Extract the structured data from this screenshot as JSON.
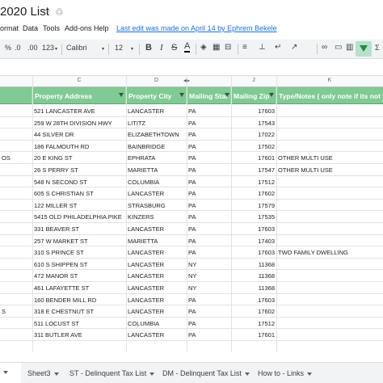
{
  "title": {
    "doc_name": "2020 List",
    "star_glyph": "☆",
    "drive_glyph": "♲"
  },
  "menu": {
    "items": [
      "ormat",
      "Data",
      "Tools",
      "Add-ons",
      "Help"
    ],
    "last_edit": "Last edit was made on April 14 by Ephrem Bekele"
  },
  "toolbar": {
    "percent": "%",
    "decimal_less": ".0",
    "decimal_more": ".00",
    "format_more": "123",
    "font": "Calibri",
    "font_size": "12",
    "bold": "B",
    "italic": "I",
    "strike": "S",
    "text_color": "A"
  },
  "columns": {
    "letters": [
      "C",
      "D",
      "",
      "",
      "J",
      "K"
    ]
  },
  "headers": {
    "address": "Property Address",
    "city": "Property City",
    "state": "Mailing Stat",
    "zip": "Mailing Zip",
    "type": "Type/Notes ( only note if its not S"
  },
  "rows": [
    {
      "edge": "",
      "address": "521 LANCASTER AVE",
      "city": "Lancaster",
      "state": "PA",
      "zip": "17603",
      "type": ""
    },
    {
      "edge": "",
      "address": "259 W 28TH DIVISION HWY",
      "city": "Lititz",
      "state": "PA",
      "zip": "17543",
      "type": ""
    },
    {
      "edge": "",
      "address": "44 SILVER DR",
      "city": "ELIZABETHTOWN",
      "state": "PA",
      "zip": "17022",
      "type": ""
    },
    {
      "edge": "",
      "address": "186 FALMOUTH RD",
      "city": "BAINBRIDGE",
      "state": "PA",
      "zip": "17502",
      "type": ""
    },
    {
      "edge": "OS",
      "address": "20 E KING ST",
      "city": "Ephrata",
      "state": "PA",
      "zip": "17601",
      "type": "OTHER MULTI USE"
    },
    {
      "edge": "",
      "address": "26 S PERRY ST",
      "city": "Marietta",
      "state": "PA",
      "zip": "17547",
      "type": "OTHER MULTI USE"
    },
    {
      "edge": "",
      "address": "548 N SECOND ST",
      "city": "COLUMBIA",
      "state": "PA",
      "zip": "17512",
      "type": ""
    },
    {
      "edge": "",
      "address": "605 S CHRISTIAN ST",
      "city": "Lancaster",
      "state": "PA",
      "zip": "17602",
      "type": ""
    },
    {
      "edge": "",
      "address": "122 MILLER ST",
      "city": "STRASBURG",
      "state": "PA",
      "zip": "17579",
      "type": ""
    },
    {
      "edge": "",
      "address": "5415 OLD PHILADELPHIA PIKE",
      "city": "Kinzers",
      "state": "PA",
      "zip": "17535",
      "type": ""
    },
    {
      "edge": "",
      "address": "331 BEAVER ST",
      "city": "Lancaster",
      "state": "PA",
      "zip": "17603",
      "type": ""
    },
    {
      "edge": "",
      "address": "257 W MARKET ST",
      "city": "Marietta",
      "state": "PA",
      "zip": "17403",
      "type": ""
    },
    {
      "edge": "",
      "address": "310 S PRINCE ST",
      "city": "Lancaster",
      "state": "PA",
      "zip": "17603",
      "type": "TWO FAMILY DWELLING"
    },
    {
      "edge": "",
      "address": "610 S SHIPPEN ST",
      "city": "Lancaster",
      "state": "NY",
      "zip": "11368",
      "type": ""
    },
    {
      "edge": "",
      "address": "472 MANOR ST",
      "city": "Lancaster",
      "state": "NY",
      "zip": "11368",
      "type": ""
    },
    {
      "edge": "",
      "address": "461 LAFAYETTE ST",
      "city": "Lancaster",
      "state": "NY",
      "zip": "11368",
      "type": ""
    },
    {
      "edge": "",
      "address": "160 BENDER MILL RD",
      "city": "Lancaster",
      "state": "PA",
      "zip": "17603",
      "type": ""
    },
    {
      "edge": "S",
      "address": "318 E CHESTNUT ST",
      "city": "Lancaster",
      "state": "PA",
      "zip": "17602",
      "type": ""
    },
    {
      "edge": "",
      "address": "511 LOCUST ST",
      "city": "COLUMBIA",
      "state": "PA",
      "zip": "17512",
      "type": ""
    },
    {
      "edge": "",
      "address": "311 BUTLER AVE",
      "city": "Lancaster",
      "state": "PA",
      "zip": "17601",
      "type": ""
    }
  ],
  "tabs": [
    {
      "label": "Sheet3"
    },
    {
      "label": "ST - Delinquent Tax List"
    },
    {
      "label": "DM - Delinquent Tax List"
    },
    {
      "label": "How to - Links"
    }
  ],
  "colors": {
    "header_green": "#81c995",
    "filter_active": "#b7e1cd",
    "link_blue": "#1a73e8"
  }
}
